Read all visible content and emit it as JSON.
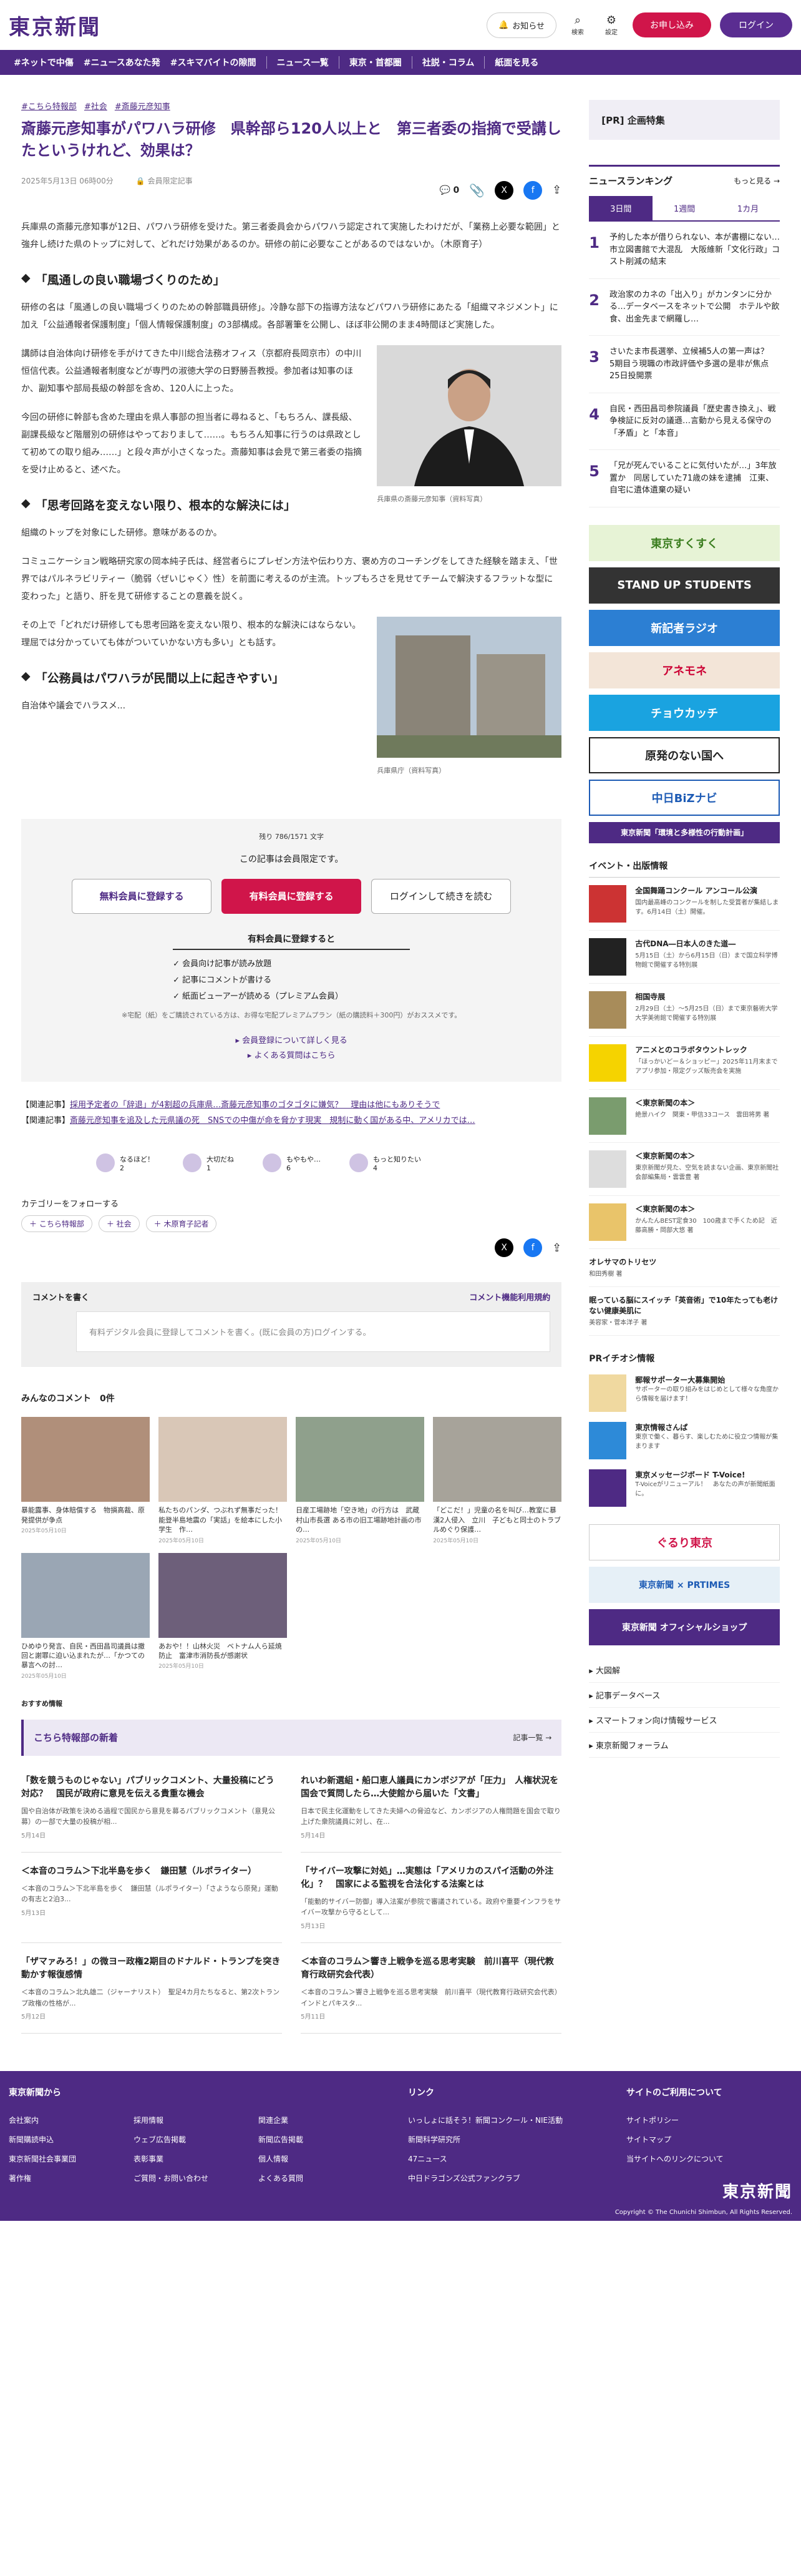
{
  "header": {
    "logo": "東京新聞",
    "notice": "お知らせ",
    "search": "検索",
    "settings": "設定",
    "signup": "お申し込み",
    "login": "ログイン"
  },
  "nav": [
    "#ネットで中傷",
    "#ニュースあなた発",
    "#スキマバイトの隙間",
    "ニュース一覧",
    "東京・首都圏",
    "社説・コラム",
    "紙面を見る"
  ],
  "article": {
    "tags": [
      "#こちら特報部",
      "#社会",
      "#斎藤元彦知事"
    ],
    "title": "斎藤元彦知事がパワハラ研修　県幹部ら120人以上と　第三者委の指摘で受講したというけれど、効果は？",
    "date": "2025年5月13日 06時00分",
    "members": "会員限定記事",
    "comment_count": "0",
    "lead": "兵庫県の斎藤元彦知事が12日、パワハラ研修を受けた。第三者委員会からパワハラ認定されて実施したわけだが、「業務上必要な範囲」と強弁し続けた県のトップに対して、どれだけ効果があるのか。研修の前に必要なことがあるのではないか。（木原育子）",
    "h1": "「風通しの良い職場づくりのため」",
    "p1": "研修の名は「風通しの良い職場づくりのための幹部職員研修」。冷静な部下の指導方法などパワハラ研修にあたる「組織マネジメント」に加え「公益通報者保護制度」「個人情報保護制度」の3部構成。各部署筆を公開し、ほぼ非公開のまま4時間ほど実施した。",
    "p2": "講師は自治体向け研修を手がけてきた中川総合法務オフィス（京都府長岡京市）の中川恒信代表。公益通報者制度などが専門の淑徳大学の日野勝吾教授。参加者は知事のほか、副知事や部局長級の幹部を含め、120人に上った。",
    "p3": "今回の研修に幹部も含めた理由を県人事部の担当者に尋ねると、「もちろん、課長級、副課長級など階層別の研修はやっておりまして……。もちろん知事に行うのは県政として初めての取り組み……」と段々声が小さくなった。斎藤知事は会見で第三者委の指摘を受け止めると、述べた。",
    "fig1_caption": "兵庫県の斎藤元彦知事（資料写真）",
    "h2": "「思考回路を変えない限り、根本的な解決には」",
    "p4": "組織のトップを対象にした研修。意味があるのか。",
    "p5": "コミュニケーション戦略研究家の岡本純子氏は、経営者らにプレゼン方法や伝わり方、褒め方のコーチングをしてきた経験を踏まえ、「世界ではパルネラビリティー（脆弱〈ぜいじゃく〉性）を前面に考えるのが主流。トップもろさを見せてチームで解決するフラットな型に変わった」と語り、肝を見て研修することの意義を説く。",
    "p6": "その上で「どれだけ研修しても思考回路を変えない限り、根本的な解決にはならない。理屈では分かっていても体がついていかない方も多い」とも話す。",
    "fig2_caption": "兵庫県庁（資料写真）",
    "h3": "「公務員はパワハラが民間以上に起きやすい」",
    "p7": "自治体や議会でハラスメ..."
  },
  "paywall": {
    "remaining": "残り 786/1571 文字",
    "main": "この記事は会員限定です。",
    "free": "無料会員に登録する",
    "paid": "有料会員に登録する",
    "login": "ログインして続きを読む",
    "sub": "有料会員に登録すると",
    "benefits": [
      "会員向け記事が読み放題",
      "記事にコメントが書ける",
      "紙面ビューアーが読める（プレミアム会員）"
    ],
    "note": "※宅配（紙）をご購読されている方は、お得な宅配プレミアムプラン（紙の購読料＋300円）がおススメです。",
    "link1": "会員登録について詳しく見る",
    "link2": "よくある質問はこちら"
  },
  "related": [
    {
      "tag": "【関連記事】",
      "text": "採用予定者の「辞退」が4割超の兵庫県…斎藤元彦知事のゴタゴタに嫌気？　理由は他にもありそうで"
    },
    {
      "tag": "【関連記事】",
      "text": "斎藤元彦知事を追及した元県議の死　SNSでの中傷が命を脅かす現実　規制に動く国がある中、アメリカでは…"
    }
  ],
  "reactions": [
    {
      "label": "なるほど！",
      "count": "2"
    },
    {
      "label": "大切だね",
      "count": "1"
    },
    {
      "label": "もやもや…",
      "count": "6"
    },
    {
      "label": "もっと知りたい",
      "count": "4"
    }
  ],
  "follow": {
    "title": "カテゴリーをフォローする",
    "chips": [
      "＋ こちら特報部",
      "＋ 社会",
      "＋ 木原育子記者"
    ]
  },
  "comment_box": {
    "title": "コメントを書く",
    "policy": "コメント機能利用規約",
    "placeholder": "有料デジタル会員に登録してコメントを書く。(既に会員の方)ログインする。"
  },
  "comments": {
    "title": "みんなのコメント",
    "count": "0件"
  },
  "thumbs": [
    {
      "t": "暴能露事、身体賠償する　物損高裁、原発提供が争点",
      "d": "2025年05月10日"
    },
    {
      "t": "私たちのパンダ、つぶれず無事だった！　能登半島地震の「実話」を絵本にした小学生　作…",
      "d": "2025年05月10日"
    },
    {
      "t": "日産工場跡地「空き地」の行方は　武蔵村山市長選 ある市の旧工場跡地計画の市の…",
      "d": "2025年05月10日"
    },
    {
      "t": "「どこだ！」児童の名を叫び…教室に暴漢2人侵入　立川　子どもと同士のトラブルめぐり保護…",
      "d": "2025年05月10日"
    },
    {
      "t": "ひめゆり発言、自民・西田昌司議員は撤回と謝罪に迫い込まれたが…「かつての暴言への討…",
      "d": "2025年05月10日"
    },
    {
      "t": "あおや！！山林火災　ベトナム人ら延焼防止　富津市消防長が感謝状",
      "d": "2025年05月10日"
    }
  ],
  "recommend": "おすすめ情報",
  "channel": {
    "title": "こちら特報部の新着",
    "more": "記事一覧 →",
    "items": [
      {
        "t": "「数を競うものじゃない」パブリックコメント、大量投稿にどう対応？　国民が政府に意見を伝える貴重な機会",
        "b": "国や自治体が政策を決める過程で国民から意見を募るパブリックコメント（意見公募）の一部で大量の投稿が相...",
        "d": "5月14日"
      },
      {
        "t": "れいわ新選組・船口恵人議員にカンボジアが「圧力」　人権状況を国会で質問したら…大使館から届いた「文書」",
        "b": "日本で民主化運動をしてきた夫婦への脅迫など、カンボジアの人権問題を国会で取り上げた衆院議員に対し、在...",
        "d": "5月14日"
      },
      {
        "t": "＜本音のコラム＞下北半島を歩く　鎌田慧（ルポライター）",
        "b": "＜本音のコラム＞下北半島を歩く　鎌田慧（ルポライター）「さようなら原発」運動の有志と2泊3...",
        "d": "5月13日"
      },
      {
        "t": "「サイバー攻撃に対処」…実態は「アメリカのスパイ活動の外注化」？　国家による監視を合法化する法案とは",
        "b": "「能動的サイバー防御」導入法案が参院で審議されている。政府や重要インフラをサイバー攻撃から守るとして...",
        "d": "5月13日"
      },
      {
        "t": "「ザマァみろ！」の微ヨー政権2期目のドナルド・トランプを突き動かす報復感情",
        "b": "＜本音のコラム＞北丸雄二（ジャーナリスト）　聖足4カ月たちなると、第2次トランプ政権の性格が...",
        "d": "5月12日"
      },
      {
        "t": "＜本音のコラム＞響き上戦争を巡る思考実験　前川喜平（現代教育行政研究会代表）",
        "b": "＜本音のコラム＞響き上戦争を巡る思考実験　前川喜平（現代教育行政研究会代表）　インドとパキスタ...",
        "d": "5月11日"
      }
    ]
  },
  "side": {
    "pr": "[PR] 企画特集",
    "ranking": "ニュースランキング",
    "more": "もっと見る →",
    "tabs": [
      "3日間",
      "1週間",
      "1カ月"
    ],
    "rank": [
      "予約した本が借りられない、本が書棚にない…市立図書館で大混乱　大阪維新「文化行政」コスト削減の結末",
      "政治家のカネの「出入り」がカンタンに分かる…データベースをネットで公開　ホテルや飲食、出金先まで網羅し…",
      "さいたま市長選挙、立候補5人の第一声は？　5期目う現職の市政評価や多選の是非が焦点　25日投開票",
      "自民・西田昌司参院議員「歴史書き換え」、戦争検証に反対の議遜…言動から見える保守の「矛盾」と「本音」",
      "「兄が死んでいることに気付いたが…」3年放置か　同居していた71歳の妹を逮捕　江東、自宅に遺体遺棄の疑い"
    ],
    "banners": [
      "東京すくすく",
      "STAND UP STUDENTS",
      "新記者ラジオ",
      "アネモネ",
      "チョウカッチ",
      "原発のない国へ",
      "中日BiZナビ",
      "東京新聞「環境と多様性の行動計画」"
    ],
    "events_h": "イベント・出版情報",
    "events": [
      {
        "t": "全国舞踊コンクール アンコール公演",
        "b": "国内最高峰のコンクールを制した受賞者が集結します。6月14日（土）開催。"
      },
      {
        "t": "古代DNA―日本人のきた道―",
        "b": "5月15日（土）から6月15日（日）まで国立科学博物館で開催する特別展"
      },
      {
        "t": "相国寺展",
        "b": "2月29日（土）～5月25日（日）まで東京藝術大学大学美術館で開催する特別展"
      },
      {
        "t": "アニメとのコラボタウントレック",
        "b": "「ほっかいどー＆ショッピー」2025年11月末までアプリ参加・限定グッズ販売会を実施"
      },
      {
        "t": "＜東京新聞の本＞",
        "b": "絶景ハイク　関東・甲信33コース　雲田将男 著"
      },
      {
        "t": "＜東京新聞の本＞",
        "b": "東京新聞が見た、空気を読まない企画、東京新聞社会部編集局・雲雲豊 著"
      },
      {
        "t": "＜東京新聞の本＞",
        "b": "かんたんBEST定食30　100歳まで手くため記　近藤高勝・岡部大悠 著"
      },
      {
        "t": "オレサマのトリセツ",
        "b": "和田秀樹 著"
      },
      {
        "t": "眠っている脳にスイッチ「英音術」で10年たっても老けない健康美肌に",
        "b": "美容家・菅本洋子 著"
      }
    ],
    "prh": "PRイチオシ情報",
    "pri": [
      {
        "t": "郵報サポーター大募集開始",
        "b": "サポーターの取り組みをはじめとして様々な角度から情報を届けます！"
      },
      {
        "t": "東京情報さんぱ",
        "b": "東京で働く、暮らす、楽しむために役立つ情報が集まります"
      },
      {
        "t": "東京メッセージボード T-Voice!",
        "b": "T-Voiceがリニューアル！　あなたの声が新聞紙面に。"
      }
    ],
    "banners2": [
      "ぐるり東京",
      "東京新聞 × PRTIMES",
      "東京新聞 オフィシャルショップ"
    ],
    "links": [
      "大図解",
      "記事データベース",
      "スマートフォン向け情報サービス",
      "東京新聞フォーラム"
    ]
  },
  "footer": {
    "col1": "東京新聞から",
    "col1_items": [
      "会社案内",
      "採用情報",
      "関連企業",
      "新聞購読申込",
      "ウェブ広告掲載",
      "新聞広告掲載",
      "東京新聞社会事業団",
      "表彰事業",
      "個人情報",
      "著作権",
      "ご質問・お問い合わせ",
      "よくある質問"
    ],
    "col2": "リンク",
    "col2_items": [
      "いっしょに話そう！新聞コンクール・NIE活動",
      "新聞科学研究所",
      "47ニュース",
      "中日ドラゴンズ公式ファンクラブ"
    ],
    "col3": "サイトのご利用について",
    "col3_items": [
      "サイトポリシー",
      "サイトマップ",
      "当サイトへのリンクについて"
    ],
    "logo": "東京新聞",
    "copyright": "Copyright © The Chunichi Shimbun, All Rights Reserved."
  }
}
